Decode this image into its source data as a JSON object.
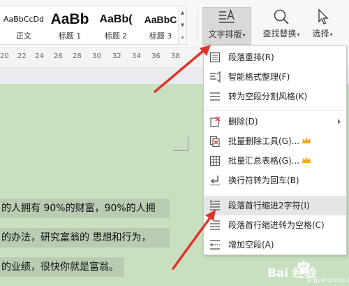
{
  "ribbon": {
    "styles": [
      {
        "preview": "AaBbCcDd",
        "name": "正文"
      },
      {
        "preview": "AaBb",
        "name": "标题 1"
      },
      {
        "preview": "AaBb(",
        "name": "标题 2"
      },
      {
        "preview": "AaBbC",
        "name": "标题 3"
      }
    ],
    "layout_button": "文字排版",
    "find_button": "查找替换",
    "select_button": "选择"
  },
  "ruler": {
    "ticks": [
      "20",
      "22",
      "24",
      "26",
      "28",
      "30",
      "32",
      "34",
      "36",
      "38"
    ]
  },
  "document": {
    "lines": [
      "的人拥有 90%的财富，90%的人拥",
      "的办法，研究富翁的 思想和行为，",
      "的业绩，很快你就是富翁。"
    ]
  },
  "menu": {
    "items": [
      {
        "label": "段落重排(R)",
        "icon": "paragraph-rearrange-icon"
      },
      {
        "label": "智能格式整理(F)",
        "icon": "smart-format-icon"
      },
      {
        "label": "转为空段分割风格(K)",
        "icon": "empty-paragraph-icon"
      },
      {
        "label": "删除(D)",
        "icon": "delete-icon"
      },
      {
        "label": "批量删除工具(G)...",
        "icon": "batch-delete-icon"
      },
      {
        "label": "批量汇总表格(G)...",
        "icon": "batch-table-icon"
      },
      {
        "label": "换行符转为回车(B)",
        "icon": "line-break-icon"
      },
      {
        "label": "段落首行缩进2字符(I)",
        "icon": "indent-2-chars-icon"
      },
      {
        "label": "段落首行缩进转为空格(C)",
        "icon": "indent-to-space-icon"
      },
      {
        "label": "增加空段(A)",
        "icon": "add-empty-paragraph-icon"
      }
    ]
  },
  "watermark": {
    "text": "Bai 经验",
    "url": "jingyan.baidu.com"
  },
  "colors": {
    "document_background": "#c8e0c0",
    "selection": "#b9ccb2",
    "annotation_arrow": "#e0342b",
    "crown": "#f5a623"
  }
}
